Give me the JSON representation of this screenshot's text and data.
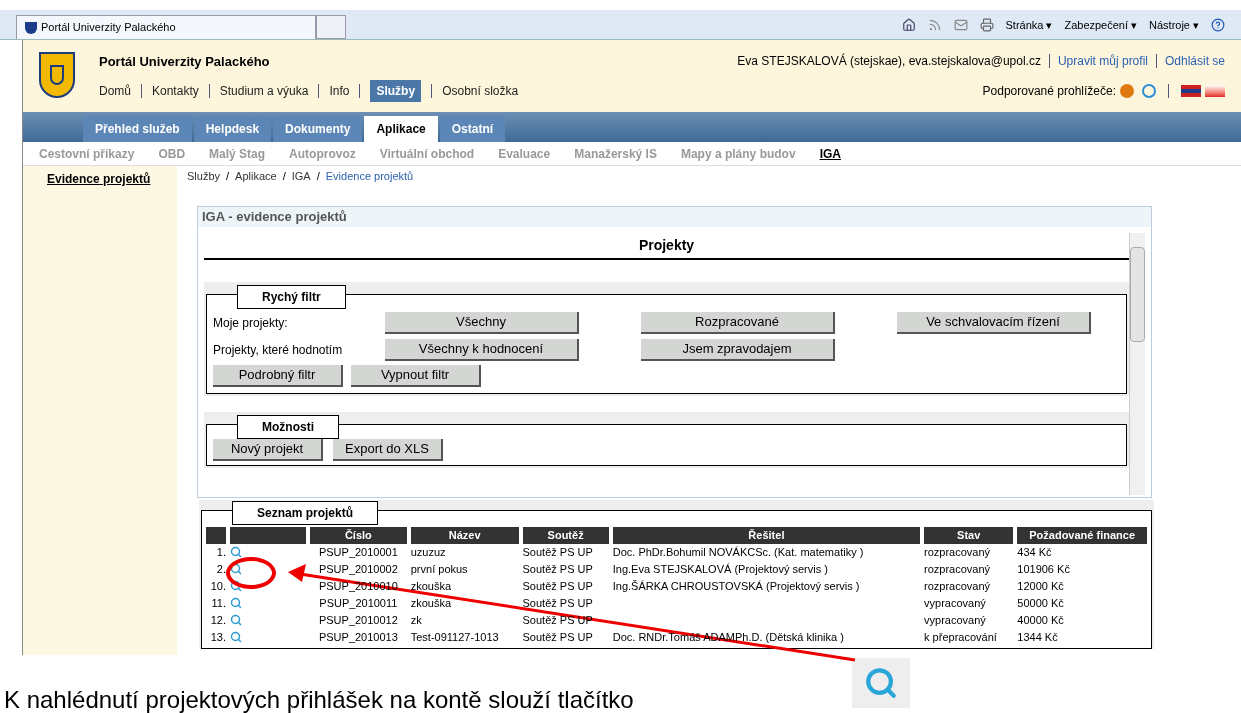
{
  "browser": {
    "tab_title": "Portál Univerzity Palackého",
    "menus": [
      {
        "label": "Stránka",
        "caret": "▾"
      },
      {
        "label": "Zabezpečení",
        "caret": "▾"
      },
      {
        "label": "Nástroje",
        "caret": "▾"
      }
    ]
  },
  "header": {
    "title": "Portál Univerzity Palackého",
    "user": "Eva STEJSKALOVÁ (stejskae), eva.stejskalova@upol.cz",
    "links": [
      "Upravit můj profil",
      "Odhlásit se"
    ],
    "nav": [
      {
        "label": "Domů",
        "selected": false
      },
      {
        "label": "Kontakty",
        "selected": false
      },
      {
        "label": "Studium a výuka",
        "selected": false
      },
      {
        "label": "Info",
        "selected": false
      },
      {
        "label": "Služby",
        "selected": true
      },
      {
        "label": "Osobní složka",
        "selected": false
      }
    ],
    "browsers_label": "Podporované prohlížeče:"
  },
  "tabs": [
    {
      "label": "Přehled služeb",
      "selected": false
    },
    {
      "label": "Helpdesk",
      "selected": false
    },
    {
      "label": "Dokumenty",
      "selected": false
    },
    {
      "label": "Aplikace",
      "selected": true
    },
    {
      "label": "Ostatní",
      "selected": false
    }
  ],
  "subnav": [
    {
      "label": "Cestovní příkazy",
      "selected": false
    },
    {
      "label": "OBD",
      "selected": false
    },
    {
      "label": "Malý Stag",
      "selected": false
    },
    {
      "label": "Autoprovoz",
      "selected": false
    },
    {
      "label": "Virtuální obchod",
      "selected": false
    },
    {
      "label": "Evaluace",
      "selected": false
    },
    {
      "label": "Manažerský IS",
      "selected": false
    },
    {
      "label": "Mapy a plány budov",
      "selected": false
    },
    {
      "label": "IGA",
      "selected": true
    }
  ],
  "sidebar": [
    {
      "label": "Evidence projektů",
      "selected": true
    }
  ],
  "breadcrumb": [
    {
      "label": "Služby"
    },
    {
      "separator": "/",
      "label": "Aplikace"
    },
    {
      "separator": "/",
      "label": "IGA"
    },
    {
      "separator": "/",
      "label": "Evidence projektů"
    }
  ],
  "panel_title": "IGA - evidence projektů",
  "heading": "Projekty",
  "quick_filter": {
    "legend": "Rychý filtr",
    "rows": [
      {
        "label": "Moje projekty:",
        "buttons": [
          "Všechny",
          "Rozpracované",
          "Ve schvalovacím řízení"
        ]
      },
      {
        "label": "Projekty, které hodnotím",
        "buttons": [
          "Všechny k hodnocení",
          "Jsem zpravodajem"
        ]
      }
    ],
    "buttons": [
      "Podrobný filtr",
      "Vypnout filtr"
    ]
  },
  "options": {
    "legend": "Možnosti",
    "buttons": [
      "Nový projekt",
      "Export do XLS"
    ]
  },
  "list": {
    "legend": "Seznam projektů",
    "columns": [
      "Číslo",
      "Název",
      "Soutěž",
      "Řešitel",
      "Stav",
      "Požadované finance"
    ],
    "rows": [
      {
        "number": "1.",
        "cells": [
          "PSUP_2010001",
          "uzuzuz",
          "Soutěž PS UP",
          "Doc. PhDr.Bohumil NOVÁKCSc. (Kat. matematiky )",
          "rozpracovaný",
          "434 Kč"
        ]
      },
      {
        "number": "2.",
        "cells": [
          "PSUP_2010002",
          "první pokus",
          "Soutěž PS UP",
          "Ing.Eva STEJSKALOVÁ (Projektový servis )",
          "rozpracovaný",
          "101906 Kč"
        ]
      },
      {
        "number": "10.",
        "cells": [
          "PSUP_2010010",
          "zkouška",
          "Soutěž PS UP",
          "Ing.ŠÁRKA CHROUSTOVSKÁ (Projektový servis )",
          "rozpracovaný",
          "12000 Kč"
        ]
      },
      {
        "number": "11.",
        "cells": [
          "PSUP_2010011",
          "zkouška",
          "Soutěž PS UP",
          "",
          "vypracovaný",
          "50000 Kč"
        ]
      },
      {
        "number": "12.",
        "cells": [
          "PSUP_2010012",
          "zk",
          "Soutěž PS UP",
          "",
          "vypracovaný",
          "40000 Kč"
        ]
      },
      {
        "number": "13.",
        "cells": [
          "PSUP_2010013",
          "Test-091127-1013",
          "Soutěž PS UP",
          "Doc. RNDr.Tomáš ADAMPh.D. (Dětská klinika )",
          "k přepracování",
          "1344 Kč"
        ]
      }
    ]
  },
  "caption": "K nahlédnutí projektových přihlášek na kontě slouží tlačítko"
}
